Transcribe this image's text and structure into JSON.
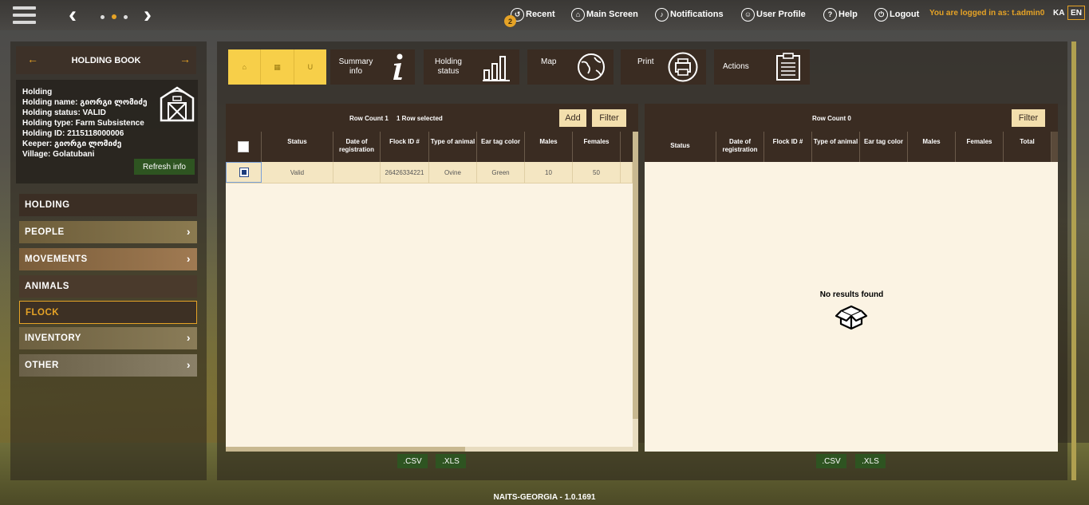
{
  "topbar": {
    "recent": "Recent",
    "recent_badge": "2",
    "main_screen": "Main Screen",
    "notifications": "Notifications",
    "user_profile": "User Profile",
    "help": "Help",
    "logout": "Logout",
    "logged_in": "You are logged in as: t.admin0",
    "lang_ka": "KA",
    "lang_en": "EN"
  },
  "sidebar": {
    "title": "HOLDING BOOK",
    "info": {
      "line1": "Holding",
      "line2": "Holding name: გიორგი ლომიძე",
      "line3": "Holding status: VALID",
      "line4": "Holding type: Farm Subsistence",
      "line5": "Holding ID: 2115118000006",
      "line6": "Keeper: გიორგი ლომიძე",
      "line7": "Village: Golatubani"
    },
    "refresh": "Refresh info",
    "menu": {
      "holding": "HOLDING",
      "people": "PEOPLE",
      "movements": "MOVEMENTS",
      "animals": "ANIMALS",
      "flock": "FLOCK",
      "inventory": "INVENTORY",
      "other": "OTHER"
    }
  },
  "toolbar": {
    "summary": "Summary info",
    "holding_status": "Holding status",
    "map": "Map",
    "print": "Print",
    "actions": "Actions"
  },
  "left_table": {
    "row_count": "Row Count 1",
    "selected": "1 Row selected",
    "add": "Add",
    "filter": "Filter",
    "headers": {
      "status": "Status",
      "date": "Date of registration",
      "flock_id": "Flock ID #",
      "type": "Type of animal",
      "ear_tag": "Ear tag color",
      "males": "Males",
      "females": "Females"
    },
    "row": {
      "status": "Valid",
      "date": "",
      "flock_id": "26426334221",
      "type": "Ovine",
      "ear_tag": "Green",
      "males": "10",
      "females": "50"
    },
    "csv": ".CSV",
    "xls": ".XLS"
  },
  "right_table": {
    "row_count": "Row Count 0",
    "filter": "Filter",
    "headers": {
      "status": "Status",
      "date": "Date of registration",
      "flock_id": "Flock ID #",
      "type": "Type of animal",
      "ear_tag": "Ear tag color",
      "males": "Males",
      "females": "Females",
      "total": "Total"
    },
    "no_results": "No results found",
    "csv": ".CSV",
    "xls": ".XLS"
  },
  "footer": "NAITS-GEORGIA - 1.0.1691"
}
